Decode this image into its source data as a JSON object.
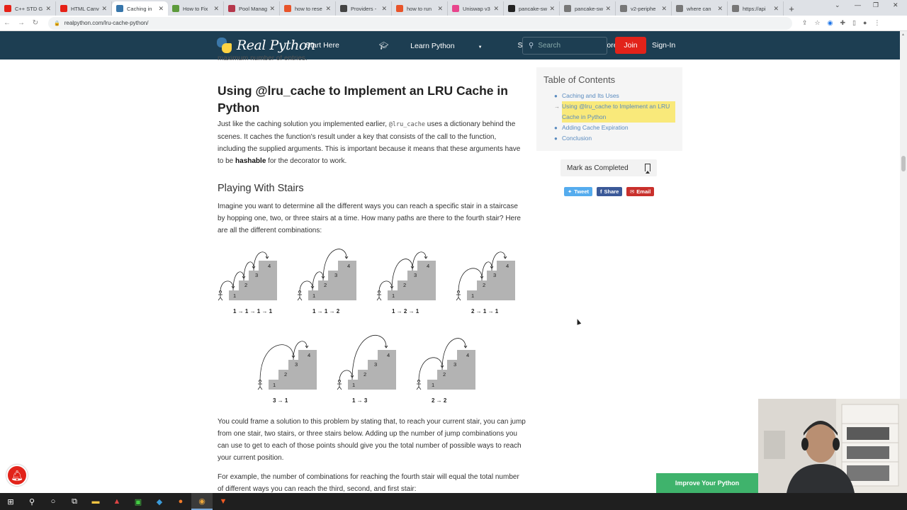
{
  "browser": {
    "tabs": [
      {
        "title": "C++ STD G",
        "color": "#e62117"
      },
      {
        "title": "HTML Canv",
        "color": "#e62117"
      },
      {
        "title": "Caching in",
        "color": "#3776ab",
        "active": true
      },
      {
        "title": "How to Fix",
        "color": "#5c9a3b"
      },
      {
        "title": "Pool Manag",
        "color": "#b5374b"
      },
      {
        "title": "how to rese",
        "color": "#e8542a"
      },
      {
        "title": "Providers -",
        "color": "#444444"
      },
      {
        "title": "how to run",
        "color": "#e8542a"
      },
      {
        "title": "Uniswap v3",
        "color": "#e8458c"
      },
      {
        "title": "pancake-sw",
        "color": "#222222"
      },
      {
        "title": "pancake-sw",
        "color": "#777777"
      },
      {
        "title": "v2-periphe",
        "color": "#777777"
      },
      {
        "title": "where can",
        "color": "#777777"
      },
      {
        "title": "https://api",
        "color": "#777777"
      }
    ],
    "url": "realpython.com/lru-cache-python/",
    "nav_back": "←",
    "nav_forward": "→",
    "nav_reload": "↻",
    "new_tab": "+"
  },
  "site": {
    "logo_text": "Real Python",
    "nav": [
      {
        "label": "Start Here",
        "dropdown": false
      },
      {
        "label": "Learn Python",
        "dropdown": true
      },
      {
        "label": "Store",
        "dropdown": true
      },
      {
        "label": "More",
        "dropdown": true
      }
    ],
    "search_placeholder": "Search",
    "join_label": "Join",
    "signin_label": "Sign-In"
  },
  "article": {
    "cut_off_text": "maximum number of entries.",
    "section_title": "Using @lru_cache to Implement an LRU Cache in Python",
    "para1_before": "Just like the caching solution you implemented earlier, ",
    "para1_code": "@lru_cache",
    "para1_after": " uses a dictionary behind the scenes. It caches the function's result under a key that consists of the call to the function, including the supplied arguments. This is important because it means that these arguments have to be ",
    "para1_bold": "hashable",
    "para1_end": " for the decorator to work.",
    "subsection_title": "Playing With Stairs",
    "para2": "Imagine you want to determine all the different ways you can reach a specific stair in a staircase by hopping one, two, or three stairs at a time. How many paths are there to the fourth stair? Here are all the different combinations:",
    "stair_labels": [
      "1 → 1 → 1 → 1",
      "1 → 1 → 2",
      "1 → 2 → 1",
      "2 → 1 → 1",
      "3 → 1",
      "1 → 3",
      "2 → 2"
    ],
    "stair_numbers": [
      "1",
      "2",
      "3",
      "4"
    ],
    "para3": "You could frame a solution to this problem by stating that, to reach your current stair, you can jump from one stair, two stairs, or three stairs below. Adding up the number of jump combinations you can use to get to each of those points should give you the total number of possible ways to reach your current position.",
    "para4": "For example, the number of combinations for reaching the fourth stair will equal the total number of different ways you can reach the third, second, and first stair:"
  },
  "toc": {
    "title": "Table of Contents",
    "items": [
      {
        "label": "Caching and Its Uses",
        "current": false
      },
      {
        "label": "Using @lru_cache to Implement an LRU Cache in Python",
        "current": true
      },
      {
        "label": "Adding Cache Expiration",
        "current": false
      },
      {
        "label": "Conclusion",
        "current": false
      }
    ],
    "mark_completed": "Mark as Completed",
    "share": [
      {
        "label": "Tweet",
        "color": "#55acee"
      },
      {
        "label": "Share",
        "color": "#3b5998"
      },
      {
        "label": "Email",
        "color": "#c9302c"
      }
    ]
  },
  "overlays": {
    "improve_label": "Improve Your Python",
    "notification_icon": "bell-icon"
  },
  "colors": {
    "nav_bg": "#1d3e52",
    "join_red": "#e2231a",
    "toc_highlight": "#f9e97a",
    "link_blue": "#5a8bbf",
    "improve_green": "#3fb36c"
  }
}
